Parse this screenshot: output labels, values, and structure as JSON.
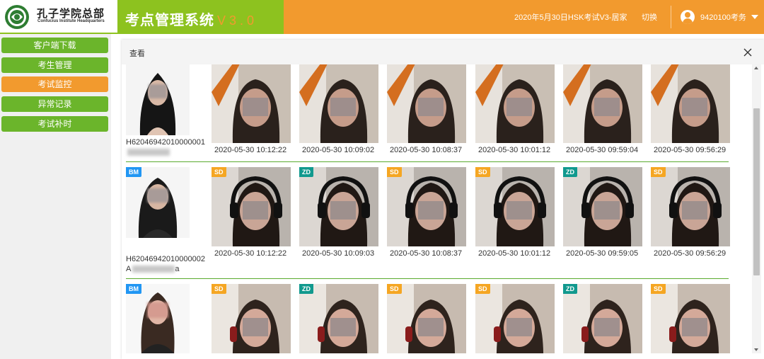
{
  "header": {
    "logo_cn": "孔子学院总部",
    "logo_en": "Confucius Institute Headquarters",
    "title": "考点管理系统",
    "version": "V3.0",
    "exam_name": "2020年5月30日HSK考试V3-居家",
    "switch_label": "切换",
    "user_name": "9420100考务",
    "user_icon": "user-avatar-icon",
    "dropdown_icon": "caret-down-icon"
  },
  "sidebar": {
    "items": [
      {
        "label": "客户端下载"
      },
      {
        "label": "考生管理"
      },
      {
        "label": "考试监控",
        "active": true
      },
      {
        "label": "异常记录"
      },
      {
        "label": "考试补时"
      }
    ]
  },
  "panel": {
    "title": "查看",
    "close_icon": "close-icon"
  },
  "candidates": [
    {
      "badge": "",
      "id": "H62046942010000001",
      "name": "",
      "snapshots": [
        {
          "time": "2020-05-30 10:12:22",
          "tag": ""
        },
        {
          "time": "2020-05-30 10:09:02",
          "tag": ""
        },
        {
          "time": "2020-05-30 10:08:37",
          "tag": ""
        },
        {
          "time": "2020-05-30 10:01:12",
          "tag": ""
        },
        {
          "time": "2020-05-30 09:59:04",
          "tag": ""
        },
        {
          "time": "2020-05-30 09:56:29",
          "tag": ""
        }
      ]
    },
    {
      "badge": "BM",
      "id": "H62046942010000002",
      "name": "A",
      "name_tail": "a",
      "snapshots": [
        {
          "time": "2020-05-30 10:12:22",
          "tag": "SD"
        },
        {
          "time": "2020-05-30 10:09:03",
          "tag": "ZD"
        },
        {
          "time": "2020-05-30 10:08:37",
          "tag": "SD"
        },
        {
          "time": "2020-05-30 10:01:12",
          "tag": "SD"
        },
        {
          "time": "2020-05-30 09:59:05",
          "tag": "ZD"
        },
        {
          "time": "2020-05-30 09:56:29",
          "tag": "SD"
        }
      ]
    },
    {
      "badge": "BM",
      "id": "",
      "name": "",
      "snapshots": [
        {
          "time": "",
          "tag": "SD"
        },
        {
          "time": "",
          "tag": "ZD"
        },
        {
          "time": "",
          "tag": "SD"
        },
        {
          "time": "",
          "tag": "SD"
        },
        {
          "time": "",
          "tag": "ZD"
        },
        {
          "time": "",
          "tag": "SD"
        }
      ]
    }
  ],
  "colors": {
    "orange": "#f29a2e",
    "green": "#8dc21f",
    "sidebar_green": "#6bb52b",
    "badge_bm": "#2196f3",
    "badge_sd": "#f5a623",
    "badge_zd": "#11998e"
  }
}
